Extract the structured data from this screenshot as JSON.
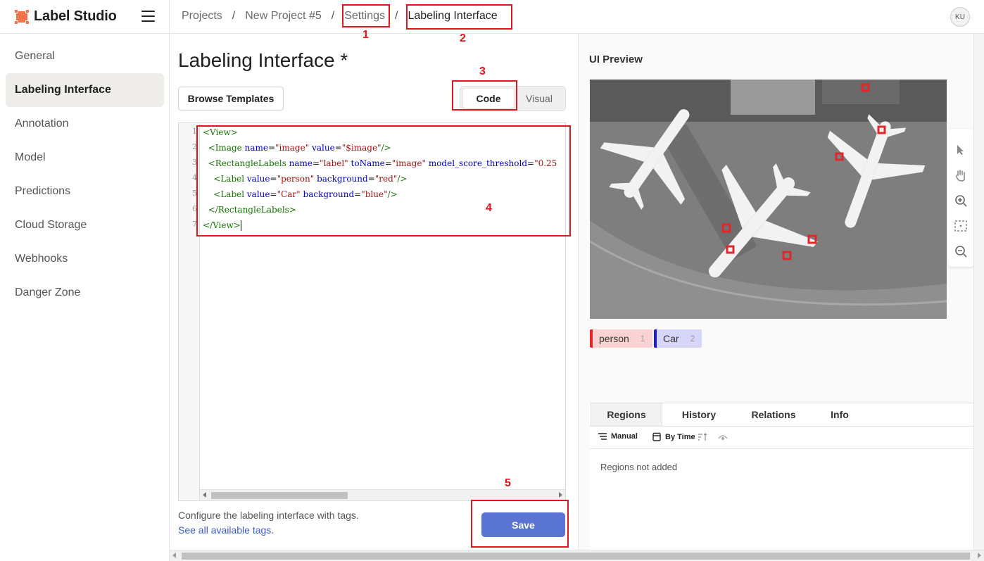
{
  "app": {
    "name": "Label Studio",
    "user_initials": "KU"
  },
  "breadcrumb": {
    "items": [
      "Projects",
      "New Project #5",
      "Settings",
      "Labeling Interface"
    ],
    "separator": "/"
  },
  "sidebar": {
    "items": [
      {
        "label": "General"
      },
      {
        "label": "Labeling Interface",
        "active": true
      },
      {
        "label": "Annotation"
      },
      {
        "label": "Model"
      },
      {
        "label": "Predictions"
      },
      {
        "label": "Cloud Storage"
      },
      {
        "label": "Webhooks"
      },
      {
        "label": "Danger Zone"
      }
    ]
  },
  "main": {
    "title": "Labeling Interface *",
    "browse_templates_label": "Browse Templates",
    "mode_toggle": {
      "code": "Code",
      "visual": "Visual",
      "selected": "Code"
    },
    "hint": "Configure the labeling interface with tags.",
    "hint_link": "See all available tags.",
    "save_label": "Save"
  },
  "editor": {
    "line_numbers": [
      "1",
      "2",
      "3",
      "4",
      "5",
      "6",
      "7"
    ],
    "lines": [
      "<View>",
      "  <Image name=\"image\" value=\"$image\"/>",
      "  <RectangleLabels name=\"label\" toName=\"image\" model_score_threshold=\"0.25",
      "    <Label value=\"person\" background=\"red\"/>",
      "    <Label value=\"Car\" background=\"blue\"/>",
      "  </RectangleLabels>",
      "</View>"
    ]
  },
  "preview": {
    "title": "UI Preview",
    "image_icon": "aerial-airport-photo",
    "toolbar_icons": [
      "pointer-icon",
      "hand-icon",
      "zoom-in-icon",
      "fit-icon",
      "zoom-out-icon"
    ],
    "labels": [
      {
        "name": "person",
        "hotkey": "1",
        "color": "#e52727"
      },
      {
        "name": "Car",
        "hotkey": "2",
        "color": "#1c1cdc"
      }
    ],
    "tabs": [
      "Regions",
      "History",
      "Relations",
      "Info"
    ],
    "active_tab": "Regions",
    "order_options": {
      "manual": "Manual",
      "by_time": "By Time"
    },
    "empty_text": "Regions not added"
  },
  "annotations": [
    "1",
    "2",
    "3",
    "4",
    "5"
  ],
  "colors": {
    "accent": "#5a74d3",
    "annotation": "#e3141b",
    "logo": "#f6734a"
  }
}
